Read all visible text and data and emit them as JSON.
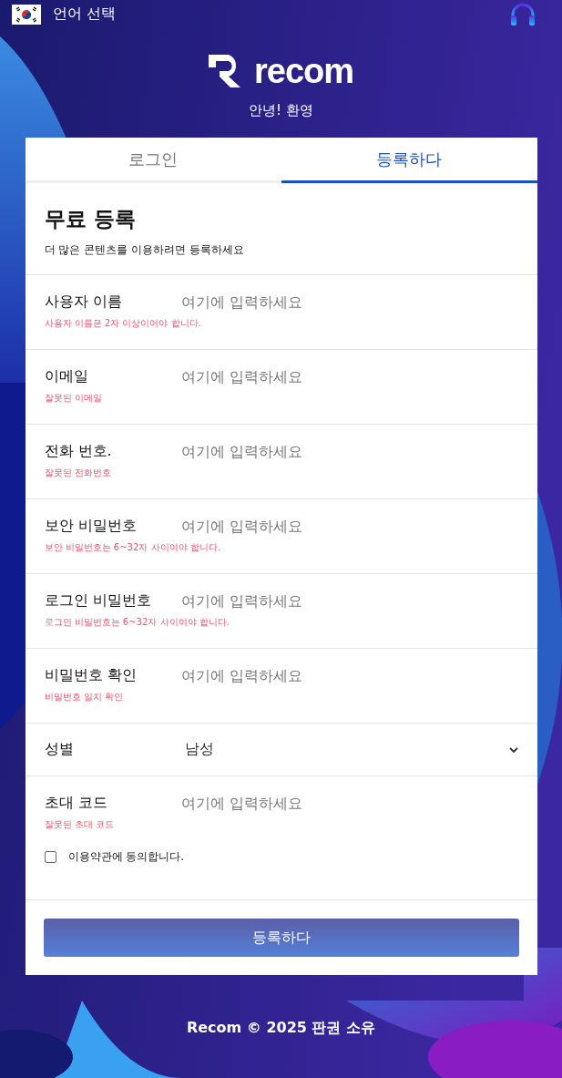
{
  "top_bar": {
    "language_label": "언어 선택"
  },
  "brand": {
    "name": "recom",
    "welcome": "안녕! 환영"
  },
  "tabs": [
    {
      "label": "로그인",
      "selected": false
    },
    {
      "label": "등록하다",
      "selected": true
    }
  ],
  "form": {
    "title": "무료 등록",
    "subtitle": "더 많은 콘텐츠를 이용하려면 등록하세요",
    "fields": [
      {
        "kind": "text",
        "label": "사용자 이름",
        "placeholder": "여기에 입력하세요",
        "error": "사용자 이름은 2자 이상이어야 합니다."
      },
      {
        "kind": "text",
        "label": "이메일",
        "placeholder": "여기에 입력하세요",
        "error": "잘못된 이메일"
      },
      {
        "kind": "text",
        "label": "전화 번호.",
        "placeholder": "여기에 입력하세요",
        "error": "잘못된 전화번호"
      },
      {
        "kind": "text",
        "label": "보안 비밀번호",
        "placeholder": "여기에 입력하세요",
        "error": "보안 비밀번호는 6~32자 사이여야 합니다."
      },
      {
        "kind": "text",
        "label": "로그인 비밀번호",
        "placeholder": "여기에 입력하세요",
        "error": "로그인 비밀번호는 6~32자 사이여야 합니다."
      },
      {
        "kind": "text",
        "label": "비밀번호 확인",
        "placeholder": "여기에 입력하세요",
        "error": "비밀번호 일치 확인"
      },
      {
        "kind": "select",
        "label": "성별",
        "value": "남성"
      },
      {
        "kind": "text",
        "label": "초대 코드",
        "placeholder": "여기에 입력하세요",
        "error": "잘못된 초대 코드"
      }
    ],
    "agree": {
      "label": "이용약관에 동의합니다.",
      "checked": false
    },
    "submit": "등록하다"
  },
  "footer": "Recom © 2025 판권 소유"
}
